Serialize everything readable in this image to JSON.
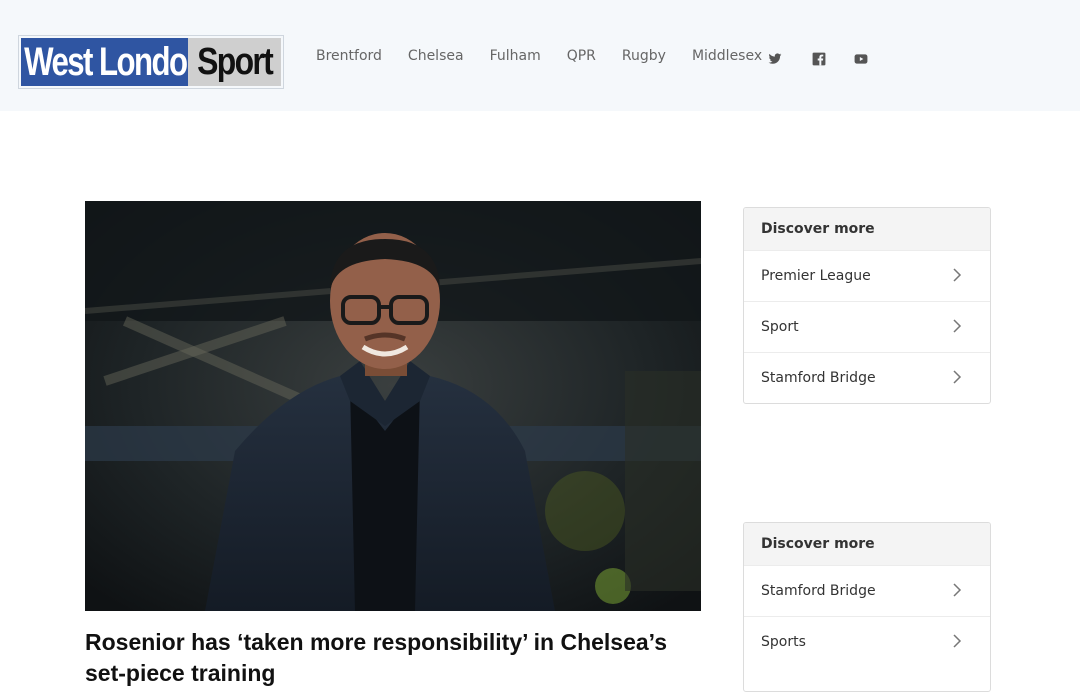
{
  "header": {
    "logo": {
      "part1": "West London",
      "part2": "Sport"
    },
    "nav": [
      "Brentford",
      "Chelsea",
      "Fulham",
      "QPR",
      "Rugby",
      "Middlesex"
    ],
    "social_icons": [
      "twitter-icon",
      "facebook-icon",
      "youtube-icon"
    ]
  },
  "article": {
    "headline": "Rosenior has ‘taken more responsibility’ in Chelsea’s set-piece training"
  },
  "sidebar": {
    "widgets": [
      {
        "title": "Discover more",
        "items": [
          "Premier League",
          "Sport",
          "Stamford Bridge"
        ]
      },
      {
        "title": "Discover more",
        "items": [
          "Stamford Bridge",
          "Sports"
        ]
      }
    ]
  },
  "colors": {
    "logo_blue": "#2f55a2",
    "logo_grey": "#cfcfcf",
    "header_bg": "#f5f8fb"
  }
}
